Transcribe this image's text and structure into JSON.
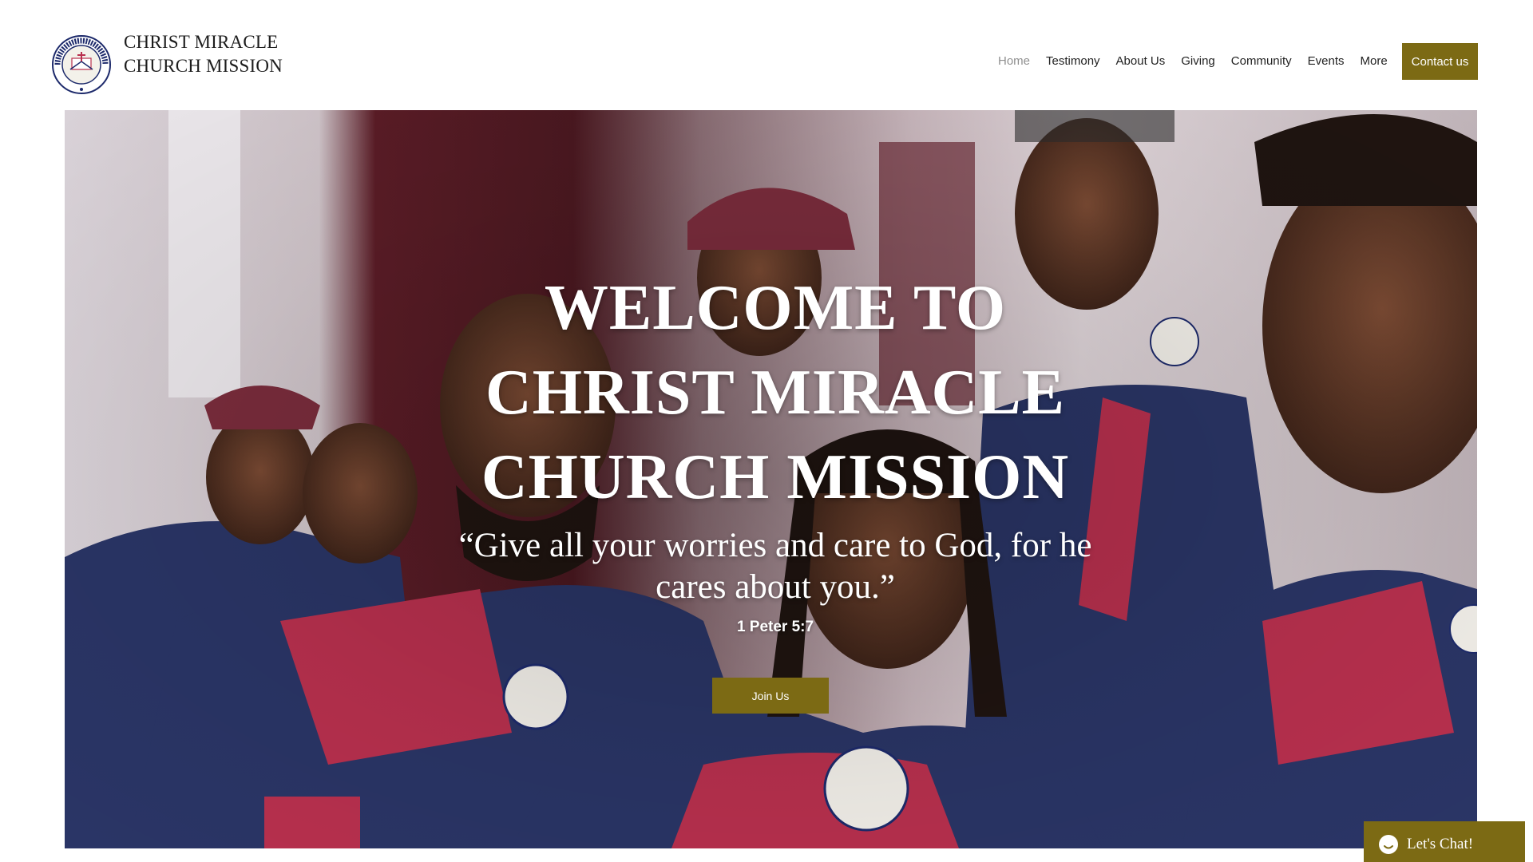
{
  "header": {
    "site_name": "CHRIST MIRACLE CHURCH MISSION",
    "logo_text": "CHRIST MIRACLE CHURCH MISSION"
  },
  "nav": {
    "items": [
      {
        "label": "Home",
        "active": true
      },
      {
        "label": "Testimony",
        "active": false
      },
      {
        "label": "About Us",
        "active": false
      },
      {
        "label": "Giving",
        "active": false
      },
      {
        "label": "Community",
        "active": false
      },
      {
        "label": "Events",
        "active": false
      },
      {
        "label": "More",
        "active": false
      }
    ],
    "contact_label": "Contact us"
  },
  "hero": {
    "title": "WELCOME TO CHRIST MIRACLE CHURCH MISSION",
    "quote": "“Give all your worries and care to God, for he cares about you.”",
    "reference": "1 Peter 5:7",
    "button_label": "Join Us"
  },
  "chat": {
    "label": "Let's Chat!"
  },
  "colors": {
    "accent": "#7c6a14",
    "gown_navy": "#2a3566",
    "gown_red": "#b8304e"
  }
}
